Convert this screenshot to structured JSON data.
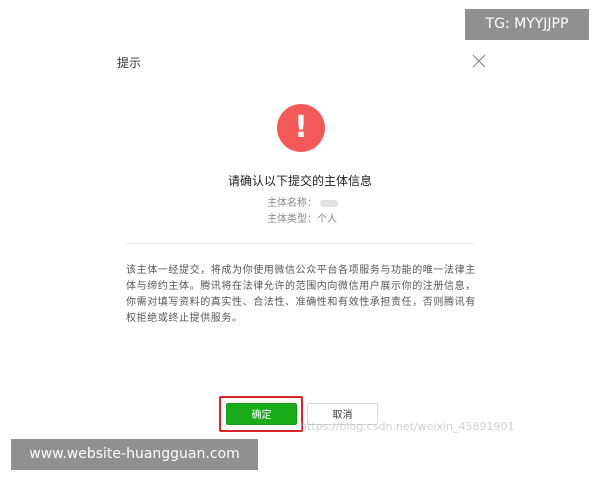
{
  "dialog": {
    "title": "提示",
    "close_icon": "close-icon",
    "alert_icon": {
      "name": "exclamation-icon",
      "glyph": "!",
      "color": "#f25a5a"
    },
    "heading": "请确认以下提交的主体信息",
    "subject_name_label": "主体名称：",
    "subject_type_label": "主体类型：",
    "subject_type_value": "个人",
    "notice_text": "该主体一经提交，将成为你使用微信公众平台各项服务与功能的唯一法律主体与缔约主体。腾讯将在法律允许的范围内向微信用户展示你的注册信息，你需对填写资料的真实性、合法性、准确性和有效性承担责任，否则腾讯有权拒绝或终止提供服务。",
    "ok_label": "确定",
    "cancel_label": "取消",
    "accent_color": "#1aad19",
    "highlight_color": "#d7262a"
  },
  "watermarks": {
    "csdn": "https://blog.csdn.net/weixin_45891901",
    "tg": "TG: MYYJJPP",
    "site": "www.website-huangguan.com"
  }
}
